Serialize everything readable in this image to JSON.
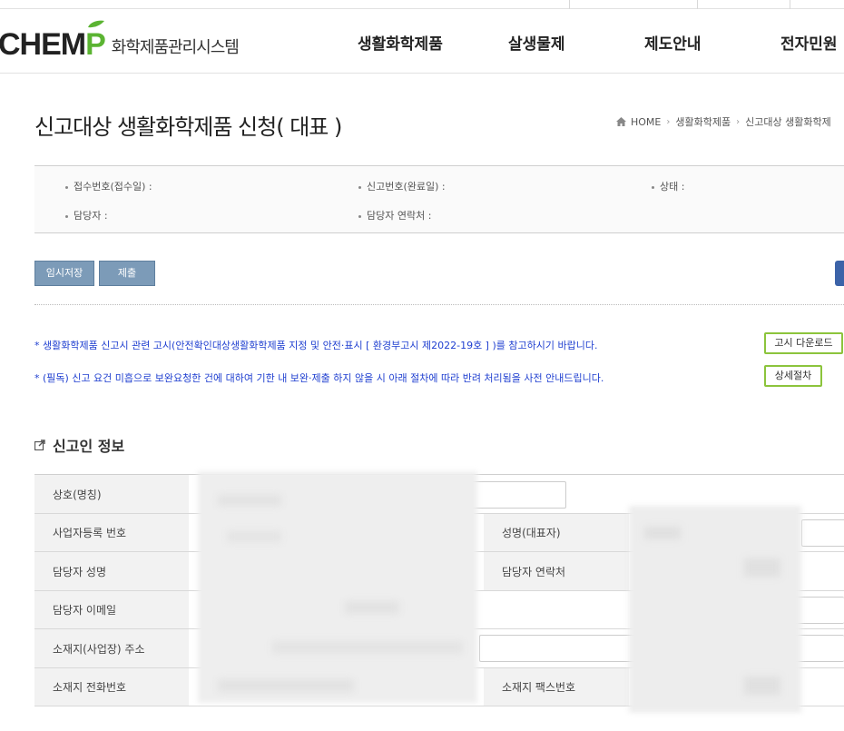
{
  "header": {
    "logo_word": "CHEM",
    "logo_p": "P",
    "logo_subtitle": "화학제품관리시스템",
    "nav": [
      "생활화학제품",
      "살생물제",
      "제도안내",
      "전자민원"
    ]
  },
  "page": {
    "title": "신고대상 생활화학제품 신청( 대표 )",
    "breadcrumb": [
      "HOME",
      "생활화학제품",
      "신고대상 생활화학제"
    ]
  },
  "info": {
    "receipt_no": "접수번호(접수일) :",
    "report_no": "신고번호(완료일) :",
    "status": "상태 :",
    "manager": "담당자 :",
    "manager_contact": "담당자 연락처 :"
  },
  "buttons": {
    "temp_save": "임시저장",
    "submit": "제출"
  },
  "notices": {
    "notice1": "* 생활화학제품 신고시 관련 고시(안전확인대상생활화학제품 지정 및 안전·표시 [ 환경부고시 제2022-19호 ] )를 참고하시기 바랍니다.",
    "notice1_button": "고시 다운로드",
    "notice2": "* (필독) 신고 요건 미흡으로 보완요청한 건에 대하여 기한 내 보완·제출 하지 않을 시 아래 절차에 따라 반려 처리됨을 사전 안내드립니다.",
    "notice2_button": "상세절차"
  },
  "section": {
    "title": "신고인 정보"
  },
  "form": {
    "company_name": "상호(명칭)",
    "business_no": "사업자등록 번호",
    "ceo_name": "성명(대표자)",
    "manager_name": "담당자 성명",
    "manager_phone": "담당자 연락처",
    "manager_email": "담당자 이메일",
    "address": "소재지(사업장) 주소",
    "phone": "소재지 전화번호",
    "fax": "소재지 팩스번호"
  },
  "colors": {
    "brand_green": "#5bb432",
    "button_blue": "#7c9bb8",
    "notice_blue": "#1f3fd0",
    "button_green_border": "#8cc43c"
  }
}
